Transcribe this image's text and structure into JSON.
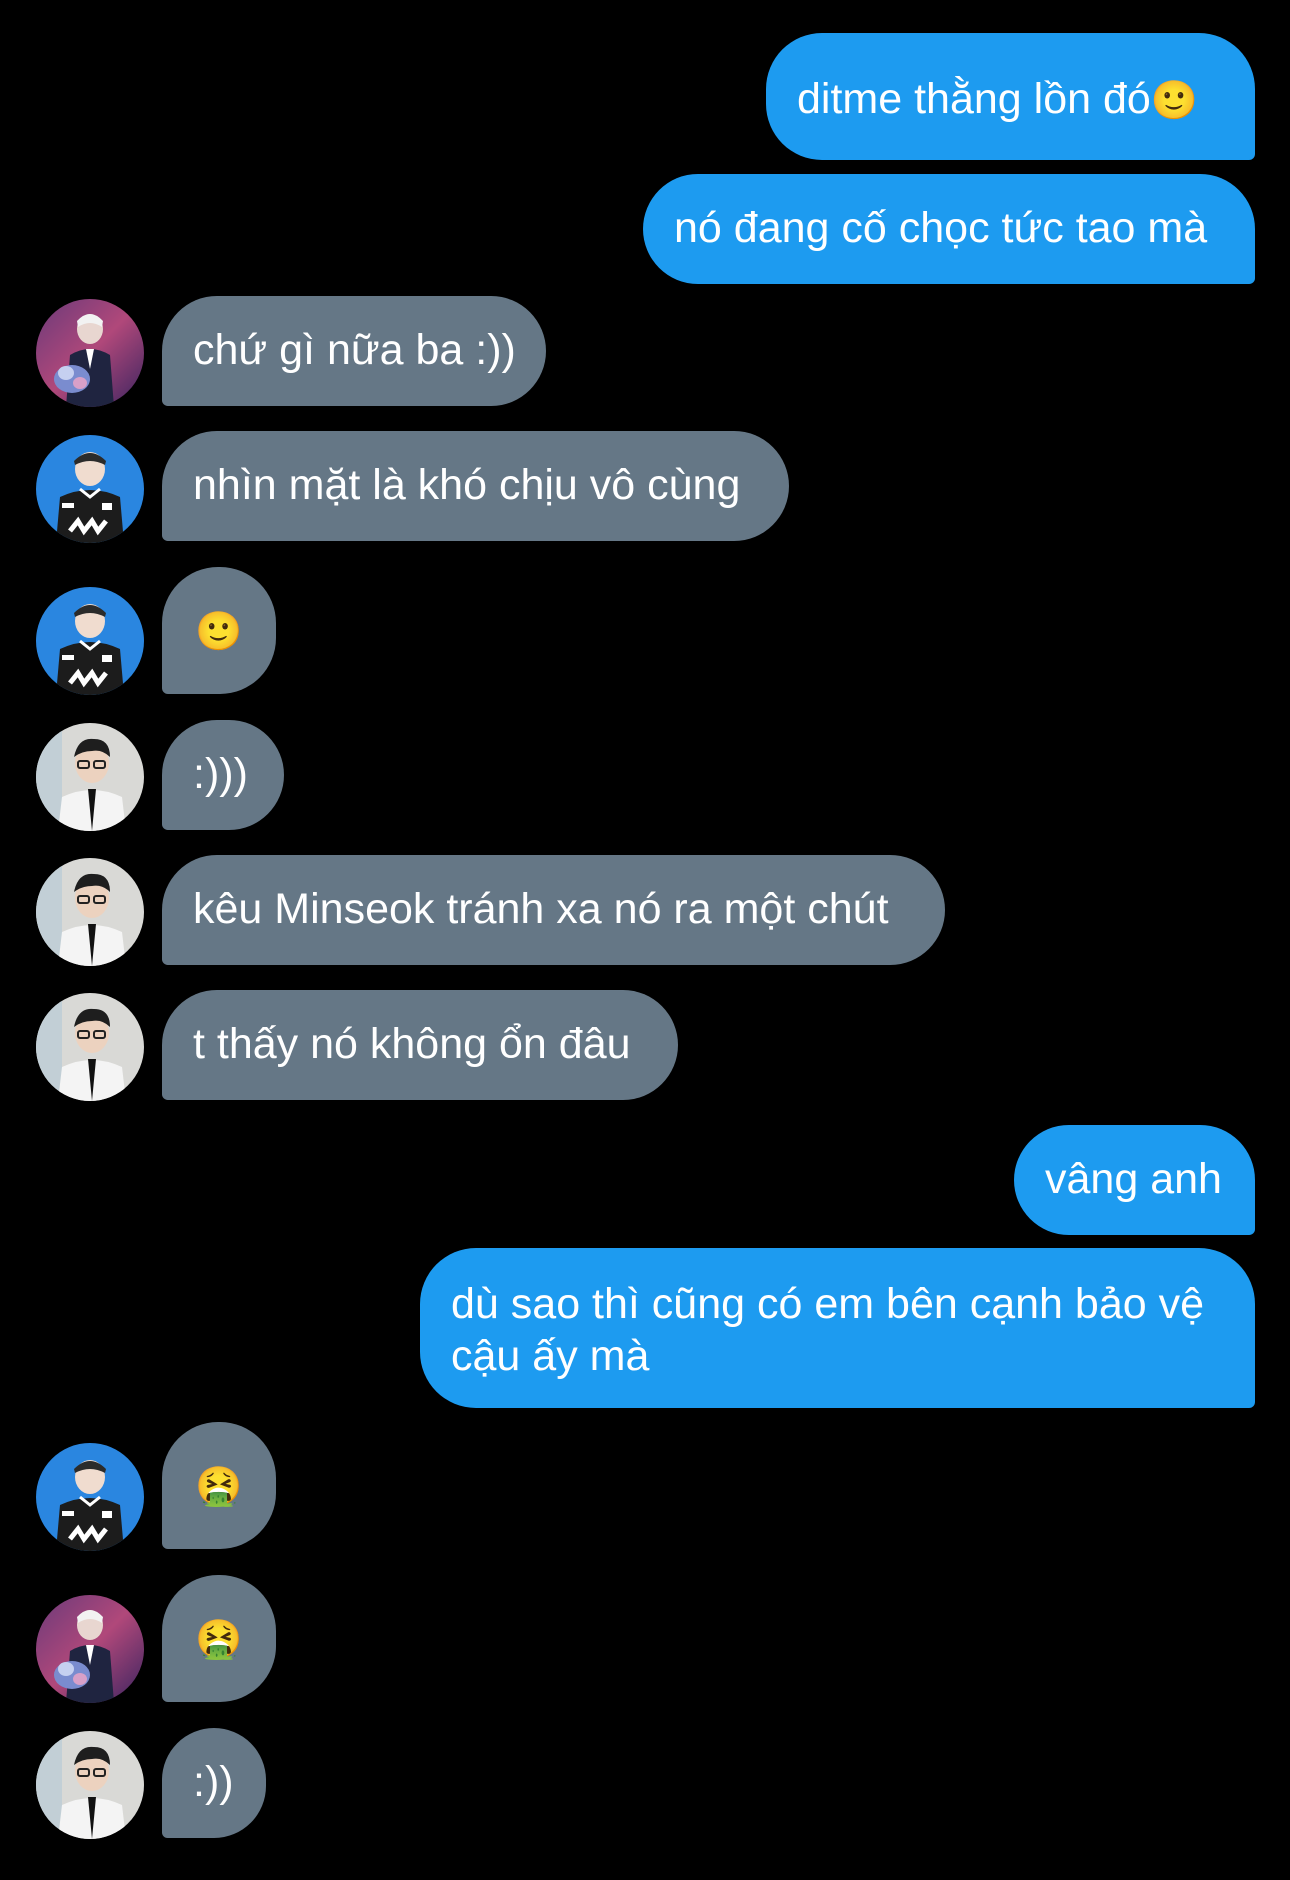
{
  "messages": [
    {
      "direction": "sent",
      "text": "ditme thằng lồn đó",
      "emoji": "🙂"
    },
    {
      "direction": "sent",
      "text": "nó đang cố chọc tức tao mà"
    },
    {
      "direction": "received",
      "avatar": "avatar-purple-stage",
      "text": "chứ gì nữa ba :))"
    },
    {
      "direction": "received",
      "avatar": "avatar-blue-jersey",
      "text": "nhìn mặt là khó chịu vô cùng"
    },
    {
      "direction": "received",
      "avatar": "avatar-blue-jersey",
      "emoji": "🙂"
    },
    {
      "direction": "received",
      "avatar": "avatar-suit-glasses",
      "text": ":)))"
    },
    {
      "direction": "received",
      "avatar": "avatar-suit-glasses",
      "text": "kêu Minseok tránh xa nó ra một chút"
    },
    {
      "direction": "received",
      "avatar": "avatar-suit-glasses",
      "text": "t thấy nó không ổn đâu"
    },
    {
      "direction": "sent",
      "text": "vâng anh"
    },
    {
      "direction": "sent",
      "text": "dù sao thì cũng có em bên cạnh bảo vệ cậu ấy mà"
    },
    {
      "direction": "received",
      "avatar": "avatar-blue-jersey",
      "emoji": "🤮"
    },
    {
      "direction": "received",
      "avatar": "avatar-purple-stage",
      "emoji": "🤮"
    },
    {
      "direction": "received",
      "avatar": "avatar-suit-glasses",
      "text": ":))"
    }
  ],
  "colors": {
    "background": "#000000",
    "sent_bubble": "#1d9bf0",
    "received_bubble": "#657786",
    "text": "#ffffff"
  }
}
